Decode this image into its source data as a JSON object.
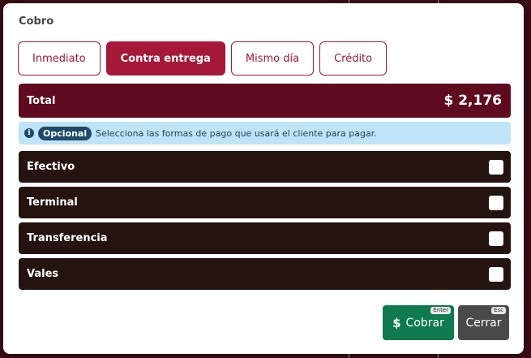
{
  "modal": {
    "title": "Cobro"
  },
  "tabs": [
    {
      "label": "Inmediato",
      "active": false
    },
    {
      "label": "Contra entrega",
      "active": true
    },
    {
      "label": "Mismo día",
      "active": false
    },
    {
      "label": "Crédito",
      "active": false
    }
  ],
  "total": {
    "label": "Total",
    "amount": "$ 2,176"
  },
  "info": {
    "icon": "info-icon",
    "icon_glyph": "i",
    "badge": "Opcional",
    "message": "Selecciona las formas de pago que usará el cliente para pagar."
  },
  "payment_methods": [
    {
      "label": "Efectivo",
      "checked": false
    },
    {
      "label": "Terminal",
      "checked": false
    },
    {
      "label": "Transferencia",
      "checked": false
    },
    {
      "label": "Vales",
      "checked": false
    }
  ],
  "footer": {
    "cobrar_label": "Cobrar",
    "cobrar_icon": "$",
    "cobrar_shortcut": "Enter",
    "cerrar_label": "Cerrar",
    "cerrar_shortcut": "Esc"
  },
  "colors": {
    "accent": "#a51838",
    "total_bg": "#5e0a1f",
    "row_bg": "#25130f",
    "info_bg": "#bfe3f7",
    "cobrar_bg": "#0f7a4d",
    "cerrar_bg": "#4a4a4a"
  }
}
